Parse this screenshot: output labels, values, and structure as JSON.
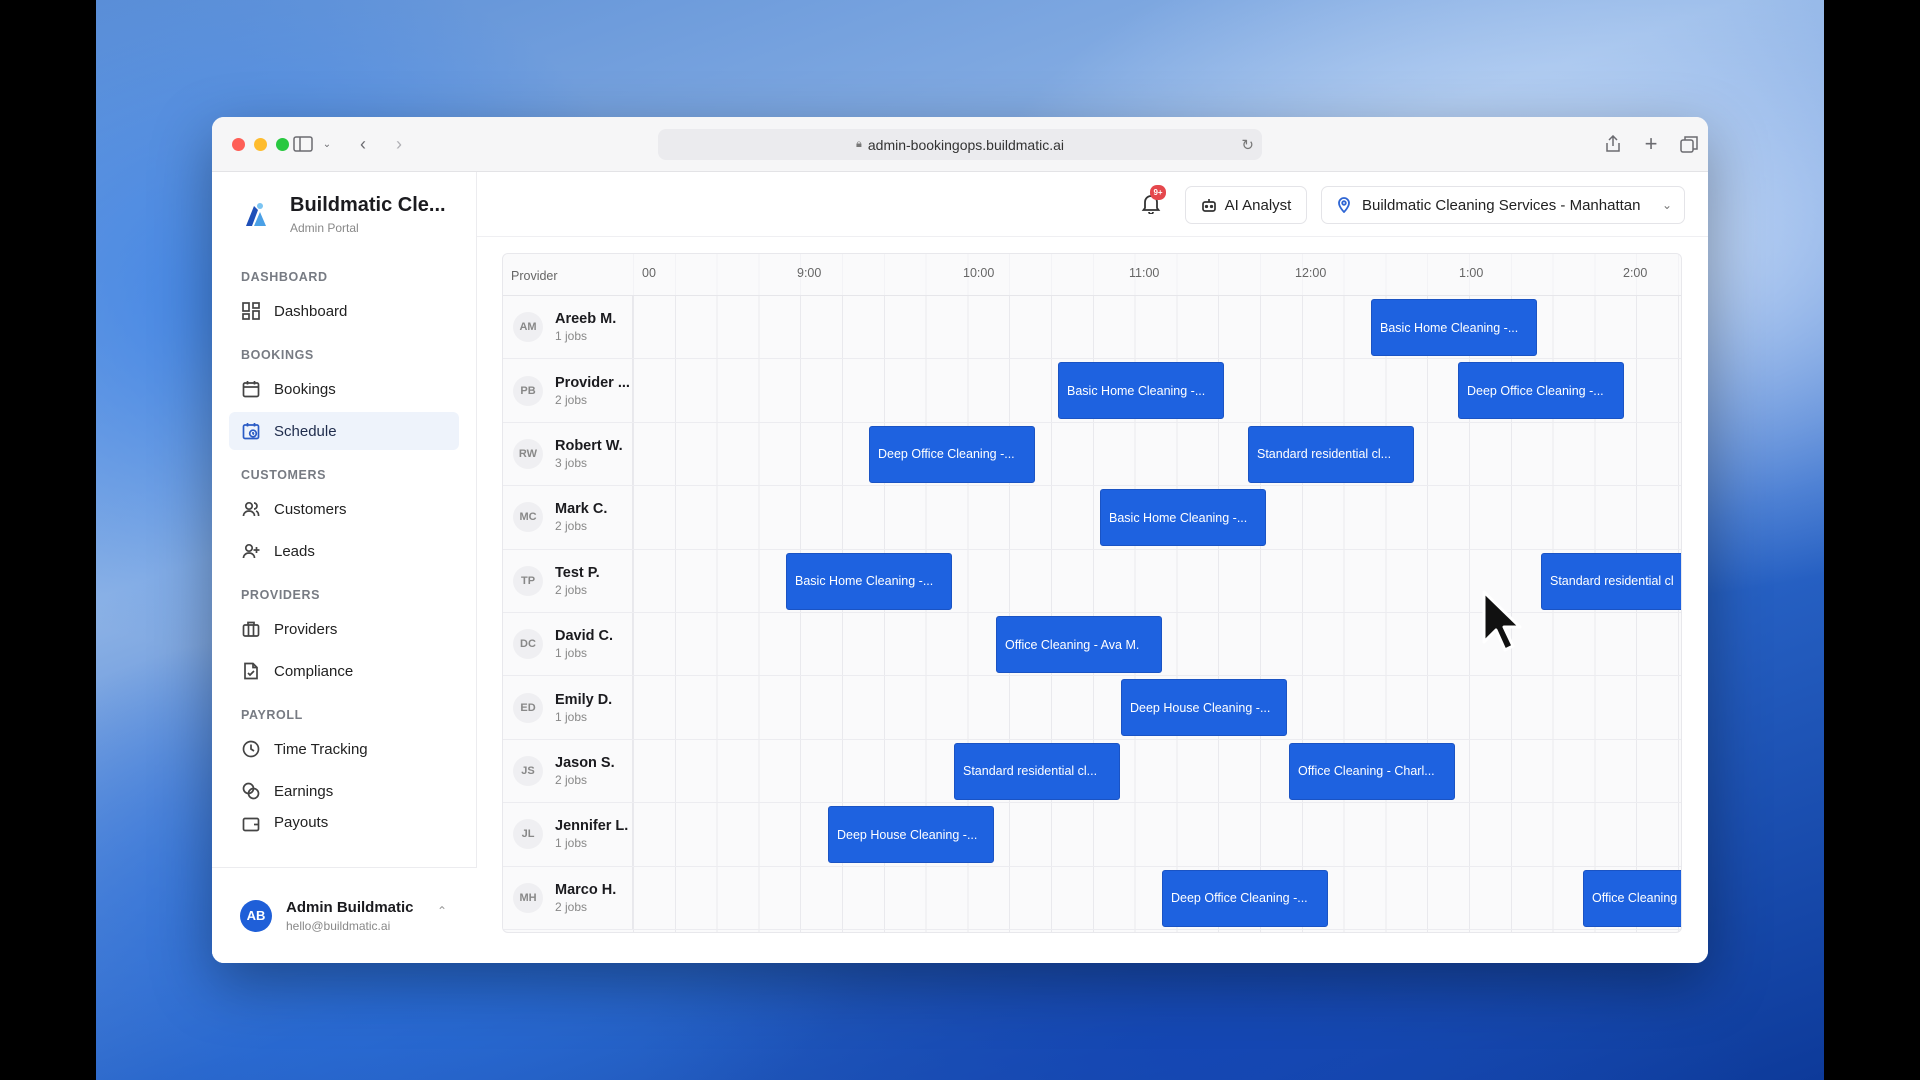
{
  "browser": {
    "url": "admin-bookingops.buildmatic.ai"
  },
  "brand": {
    "name": "Buildmatic Cle...",
    "subtitle": "Admin Portal"
  },
  "nav": {
    "dashboard_section": "DASHBOARD",
    "dashboard": "Dashboard",
    "bookings_section": "BOOKINGS",
    "bookings": "Bookings",
    "schedule": "Schedule",
    "customers_section": "CUSTOMERS",
    "customers": "Customers",
    "leads": "Leads",
    "providers_section": "PROVIDERS",
    "providers": "Providers",
    "compliance": "Compliance",
    "payroll_section": "PAYROLL",
    "time_tracking": "Time Tracking",
    "earnings": "Earnings",
    "payouts": "Payouts"
  },
  "user": {
    "initials": "AB",
    "name": "Admin Buildmatic",
    "email": "hello@buildmatic.ai"
  },
  "topbar": {
    "notification_badge": "9+",
    "ai_analyst": "AI Analyst",
    "location": "Buildmatic Cleaning Services - Manhattan"
  },
  "schedule": {
    "provider_header": "Provider",
    "times": [
      "00",
      "9:00",
      "10:00",
      "11:00",
      "12:00",
      "1:00",
      "2:00"
    ],
    "providers": [
      {
        "initials": "AM",
        "name": "Areeb M.",
        "jobs": "1 jobs"
      },
      {
        "initials": "PB",
        "name": "Provider ...",
        "jobs": "2 jobs"
      },
      {
        "initials": "RW",
        "name": "Robert W.",
        "jobs": "3 jobs"
      },
      {
        "initials": "MC",
        "name": "Mark C.",
        "jobs": "2 jobs"
      },
      {
        "initials": "TP",
        "name": "Test P.",
        "jobs": "2 jobs"
      },
      {
        "initials": "DC",
        "name": "David C.",
        "jobs": "1 jobs"
      },
      {
        "initials": "ED",
        "name": "Emily D.",
        "jobs": "1 jobs"
      },
      {
        "initials": "JS",
        "name": "Jason S.",
        "jobs": "2 jobs"
      },
      {
        "initials": "JL",
        "name": "Jennifer L.",
        "jobs": "1 jobs"
      },
      {
        "initials": "MH",
        "name": "Marco H.",
        "jobs": "2 jobs"
      }
    ],
    "jobs": [
      {
        "row": 0,
        "label": "Basic Home Cleaning -..."
      },
      {
        "row": 1,
        "label": "Basic Home Cleaning -..."
      },
      {
        "row": 1,
        "label": "Deep Office Cleaning -..."
      },
      {
        "row": 2,
        "label": "Deep Office Cleaning -..."
      },
      {
        "row": 2,
        "label": "Standard residential cl..."
      },
      {
        "row": 3,
        "label": "Basic Home Cleaning -..."
      },
      {
        "row": 4,
        "label": "Basic Home Cleaning -..."
      },
      {
        "row": 4,
        "label": "Standard residential cl"
      },
      {
        "row": 5,
        "label": "Office Cleaning - Ava M."
      },
      {
        "row": 6,
        "label": "Deep House Cleaning -..."
      },
      {
        "row": 7,
        "label": "Standard residential cl..."
      },
      {
        "row": 7,
        "label": "Office Cleaning - Charl..."
      },
      {
        "row": 8,
        "label": "Deep House Cleaning -..."
      },
      {
        "row": 9,
        "label": "Deep Office Cleaning -..."
      },
      {
        "row": 9,
        "label": "Office Cleaning"
      }
    ]
  },
  "colors": {
    "job_block": "#1e62e0",
    "active_nav_bg": "#eef3fb",
    "badge": "#e5484d"
  }
}
